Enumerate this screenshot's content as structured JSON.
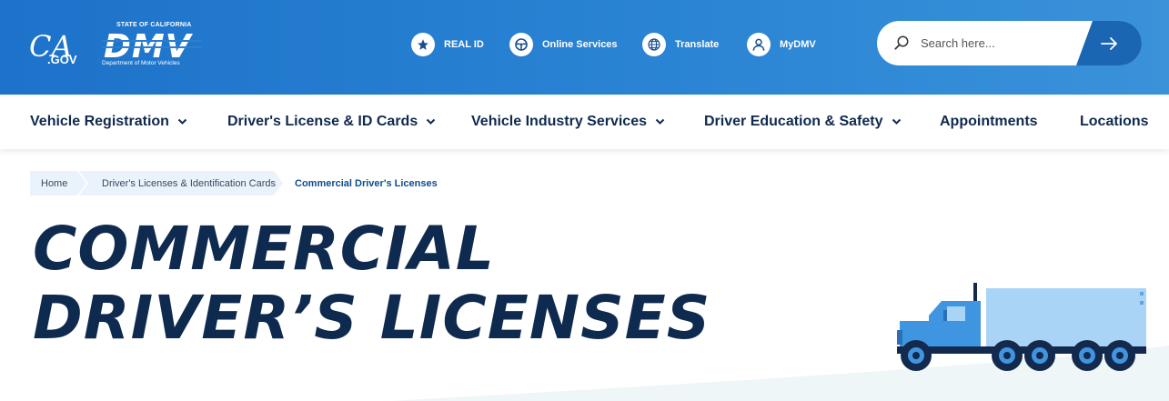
{
  "header": {
    "ca_logo_text": "CA.GOV",
    "dmv_logo_state": "STATE OF CALIFORNIA",
    "dmv_logo_mark": "DMV",
    "dmv_logo_sub": "Department of Motor Vehicles",
    "utility_links": [
      {
        "label": "REAL ID",
        "icon": "star-icon"
      },
      {
        "label": "Online Services",
        "icon": "steering-wheel-icon"
      },
      {
        "label": "Translate",
        "icon": "globe-icon"
      },
      {
        "label": "MyDMV",
        "icon": "user-icon"
      }
    ],
    "search": {
      "placeholder": "Search here...",
      "value": ""
    }
  },
  "nav": {
    "items": [
      {
        "label": "Vehicle Registration",
        "has_dropdown": true
      },
      {
        "label": "Driver's License & ID Cards",
        "has_dropdown": true
      },
      {
        "label": "Vehicle Industry Services",
        "has_dropdown": true
      },
      {
        "label": "Driver Education & Safety",
        "has_dropdown": true
      },
      {
        "label": "Appointments",
        "has_dropdown": false
      },
      {
        "label": "Locations",
        "has_dropdown": false
      }
    ]
  },
  "breadcrumb": [
    "Home",
    "Driver's Licenses & Identification Cards",
    "Commercial Driver's Licenses"
  ],
  "page": {
    "title_line1": "COMMERCIAL",
    "title_line2": "DRIVER’S LICENSES"
  },
  "colors": {
    "header_blue": "#1d72c9",
    "search_button_blue": "#1a66b3",
    "navy_text": "#0f2a4f",
    "breadcrumb_bg": "#eaf2fb",
    "truck_light_blue": "#a9d4f5",
    "truck_mid_blue": "#3f95e0",
    "truck_dark_navy": "#132a4e"
  }
}
